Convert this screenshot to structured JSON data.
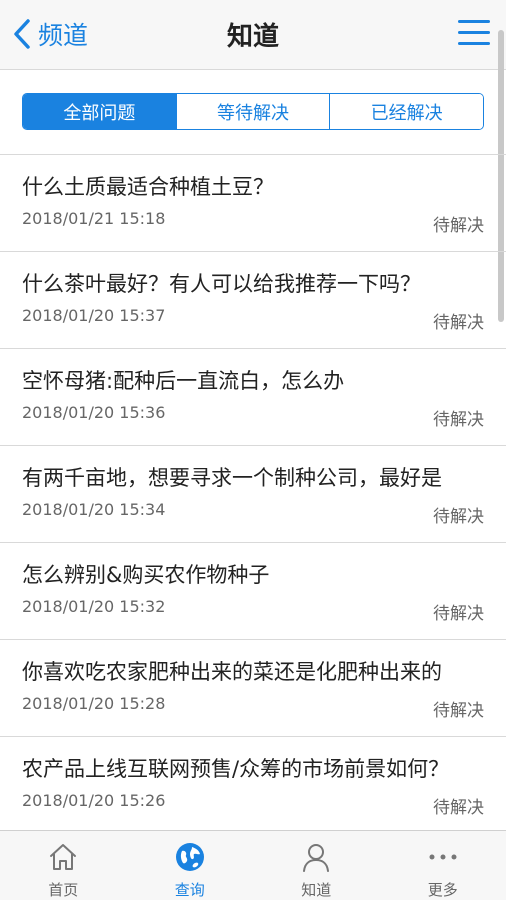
{
  "header": {
    "back_label": "频道",
    "title": "知道"
  },
  "segments": [
    {
      "label": "全部问题",
      "active": true
    },
    {
      "label": "等待解决",
      "active": false
    },
    {
      "label": "已经解决",
      "active": false
    }
  ],
  "questions": [
    {
      "title": "什么土质最适合种植土豆？",
      "date": "2018/01/21 15:18",
      "status": "待解决"
    },
    {
      "title": "什么茶叶最好？有人可以给我推荐一下吗？",
      "date": "2018/01/20 15:37",
      "status": "待解决"
    },
    {
      "title": "空怀母猪:配种后一直流白，怎么办",
      "date": "2018/01/20 15:36",
      "status": "待解决"
    },
    {
      "title": "有两千亩地，想要寻求一个制种公司，最好是",
      "date": "2018/01/20 15:34",
      "status": "待解决"
    },
    {
      "title": "怎么辨别&购买农作物种子",
      "date": "2018/01/20 15:32",
      "status": "待解决"
    },
    {
      "title": "你喜欢吃农家肥种出来的菜还是化肥种出来的",
      "date": "2018/01/20 15:28",
      "status": "待解决"
    },
    {
      "title": "农产品上线互联网预售/众筹的市场前景如何？",
      "date": "2018/01/20 15:26",
      "status": "待解决"
    }
  ],
  "bottom_nav": [
    {
      "label": "首页",
      "icon": "home-icon",
      "active": false
    },
    {
      "label": "查询",
      "icon": "globe-icon",
      "active": true
    },
    {
      "label": "知道",
      "icon": "person-icon",
      "active": false
    },
    {
      "label": "更多",
      "icon": "more-icon",
      "active": false
    }
  ],
  "colors": {
    "accent": "#1a82e0",
    "text": "#222222",
    "secondary_text": "#666666",
    "header_bg": "#f7f7f7"
  }
}
